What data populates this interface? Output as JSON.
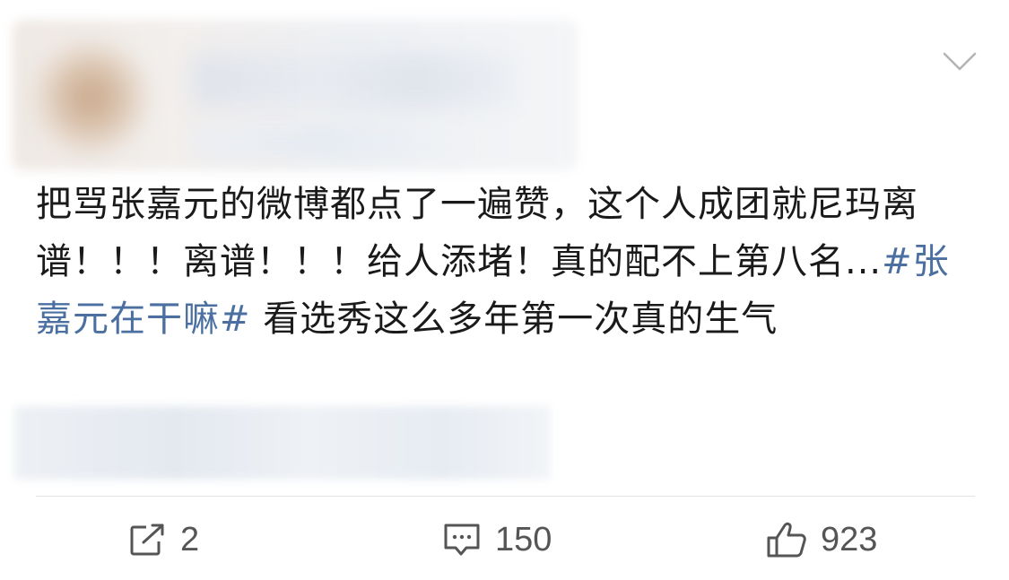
{
  "post": {
    "text_before": "把骂张嘉元的微博都点了一遍赞，这个人成团就尼玛离谱！！！离谱！！！给人添堵！真的配不上第八名...",
    "hashtag": "#张嘉元在干嘛#",
    "text_after": " 看选秀这么多年第一次真的生气",
    "hashtag_color": "#4a6fa0",
    "text_color": "#1a1a1a"
  },
  "header": {
    "more_icon": "chevron-down-icon"
  },
  "actions": {
    "repost": {
      "icon": "repost-icon",
      "count": "2"
    },
    "comment": {
      "icon": "comment-icon",
      "count": "150"
    },
    "like": {
      "icon": "thumbs-up-icon",
      "count": "923"
    }
  }
}
